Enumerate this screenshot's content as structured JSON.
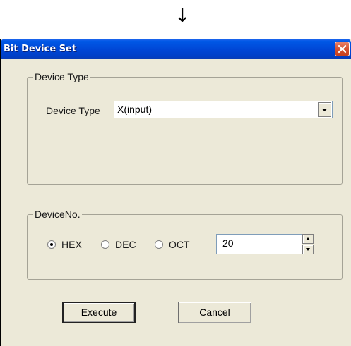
{
  "annotation": {
    "arrow": "↓"
  },
  "window": {
    "title": "Bit Device Set"
  },
  "device_type_group": {
    "legend": "Device Type",
    "field_label": "Device Type",
    "selected_value": "X(input)"
  },
  "device_no_group": {
    "legend": "DeviceNo.",
    "radios": [
      {
        "label": "HEX",
        "checked": true
      },
      {
        "label": "DEC",
        "checked": false
      },
      {
        "label": "OCT",
        "checked": false
      }
    ],
    "value": "20"
  },
  "buttons": {
    "execute": "Execute",
    "cancel": "Cancel"
  },
  "icons": {
    "close": "close-icon",
    "dropdown": "chevron-down-icon",
    "spin_up": "spin-up-icon",
    "spin_down": "spin-down-icon"
  },
  "colors": {
    "titlebar": "#0046d5",
    "dialog_bg": "#ece9d8",
    "close": "#d65433"
  }
}
